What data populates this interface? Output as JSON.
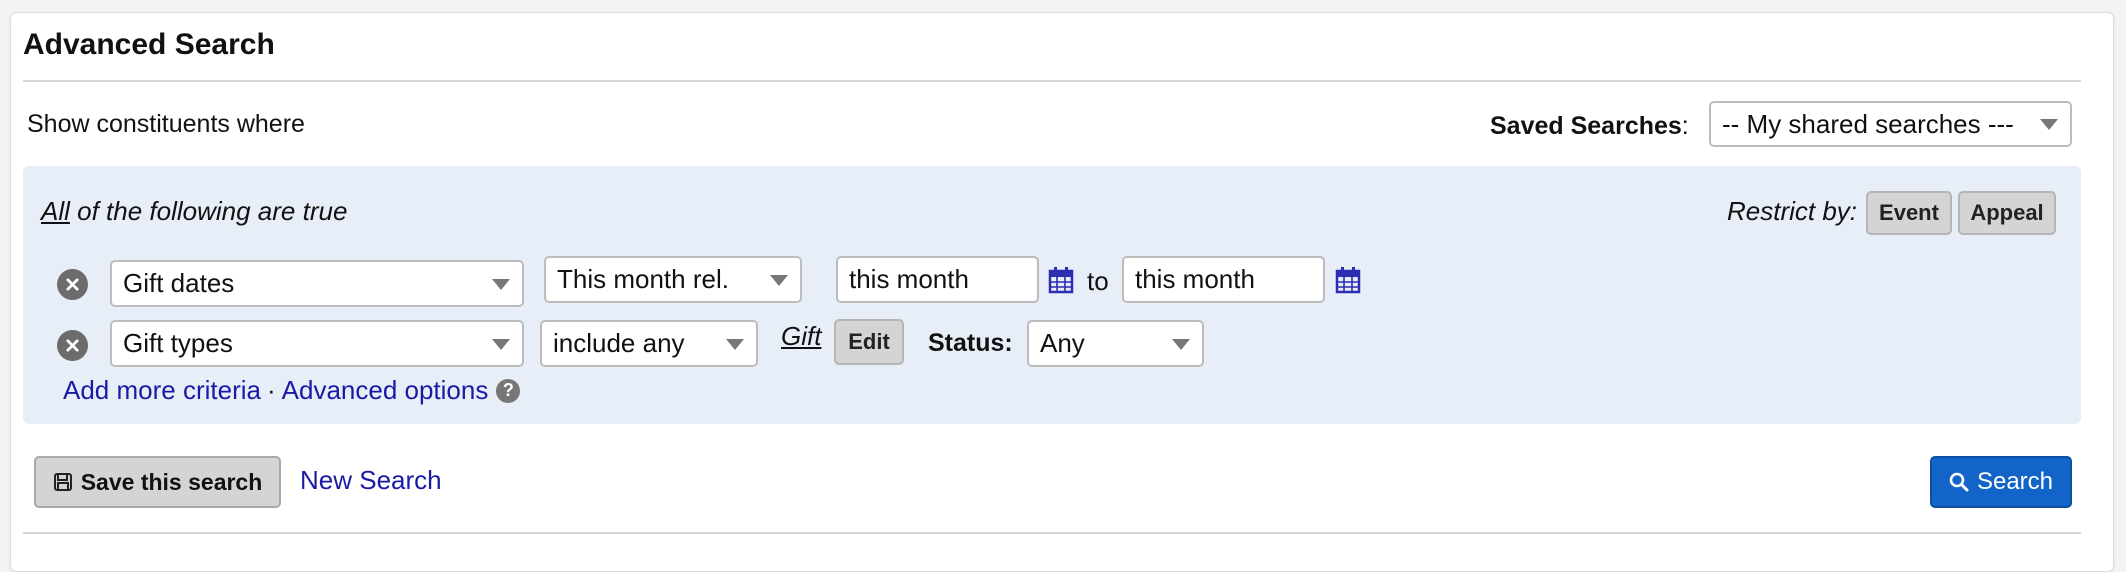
{
  "header": {
    "title": "Advanced Search"
  },
  "intro": {
    "show_where": "Show constituents where"
  },
  "saved_searches": {
    "label": "Saved Searches",
    "colon": ":",
    "selected": "-- My shared searches ---"
  },
  "criteria": {
    "all_link": "All",
    "all_rest": " of the following are true",
    "restrict_label": "Restrict by:",
    "restrict_buttons": [
      "Event",
      "Appeal"
    ],
    "rows": [
      {
        "field": "Gift dates",
        "operator": "This month rel.",
        "from_value": "this month",
        "to_word": "to",
        "to_value": "this month"
      },
      {
        "field": "Gift types",
        "operator": "include any",
        "gift_link": "Gift",
        "edit_label": "Edit",
        "status_label": "Status:",
        "status_value": "Any"
      }
    ],
    "add_more": "Add more criteria",
    "separator": "·",
    "advanced_options": "Advanced options",
    "help_glyph": "?"
  },
  "footer": {
    "save_label": "Save this search",
    "new_search": "New Search",
    "search_label": "Search"
  },
  "icons": {
    "remove": "remove-circle-icon",
    "calendar": "calendar-icon",
    "help": "help-circle-icon",
    "save": "floppy-disk-icon",
    "search": "magnifier-icon"
  },
  "colors": {
    "link": "#1a1aa6",
    "primary": "#1264c9",
    "criteria_bg": "#e7eef7",
    "calendar": "#2d2db3"
  }
}
